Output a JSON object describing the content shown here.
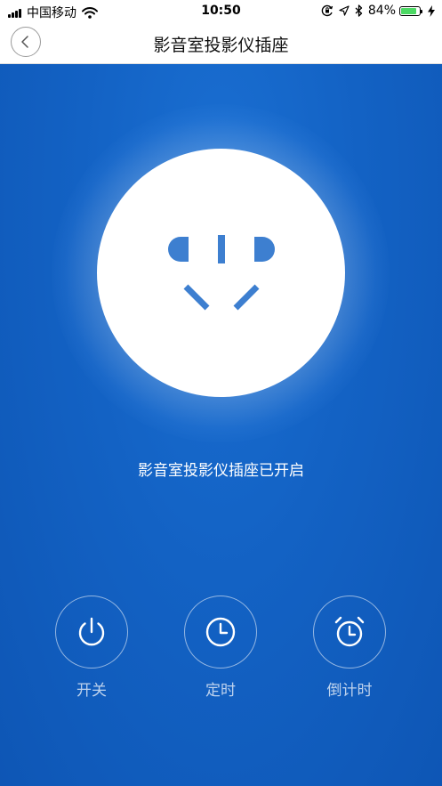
{
  "status_bar": {
    "carrier": "中国移动",
    "time": "10:50",
    "battery_percent": "84%",
    "battery_level": 0.84
  },
  "nav": {
    "title": "影音室投影仪插座"
  },
  "main": {
    "status_text": "影音室投影仪插座已开启"
  },
  "controls": [
    {
      "label": "开关",
      "icon": "power-icon"
    },
    {
      "label": "定时",
      "icon": "clock-icon"
    },
    {
      "label": "倒计时",
      "icon": "alarm-clock-icon"
    }
  ],
  "colors": {
    "background": "#1362c4",
    "plug_icon": "#3d7fd0",
    "battery": "#4cd964"
  }
}
